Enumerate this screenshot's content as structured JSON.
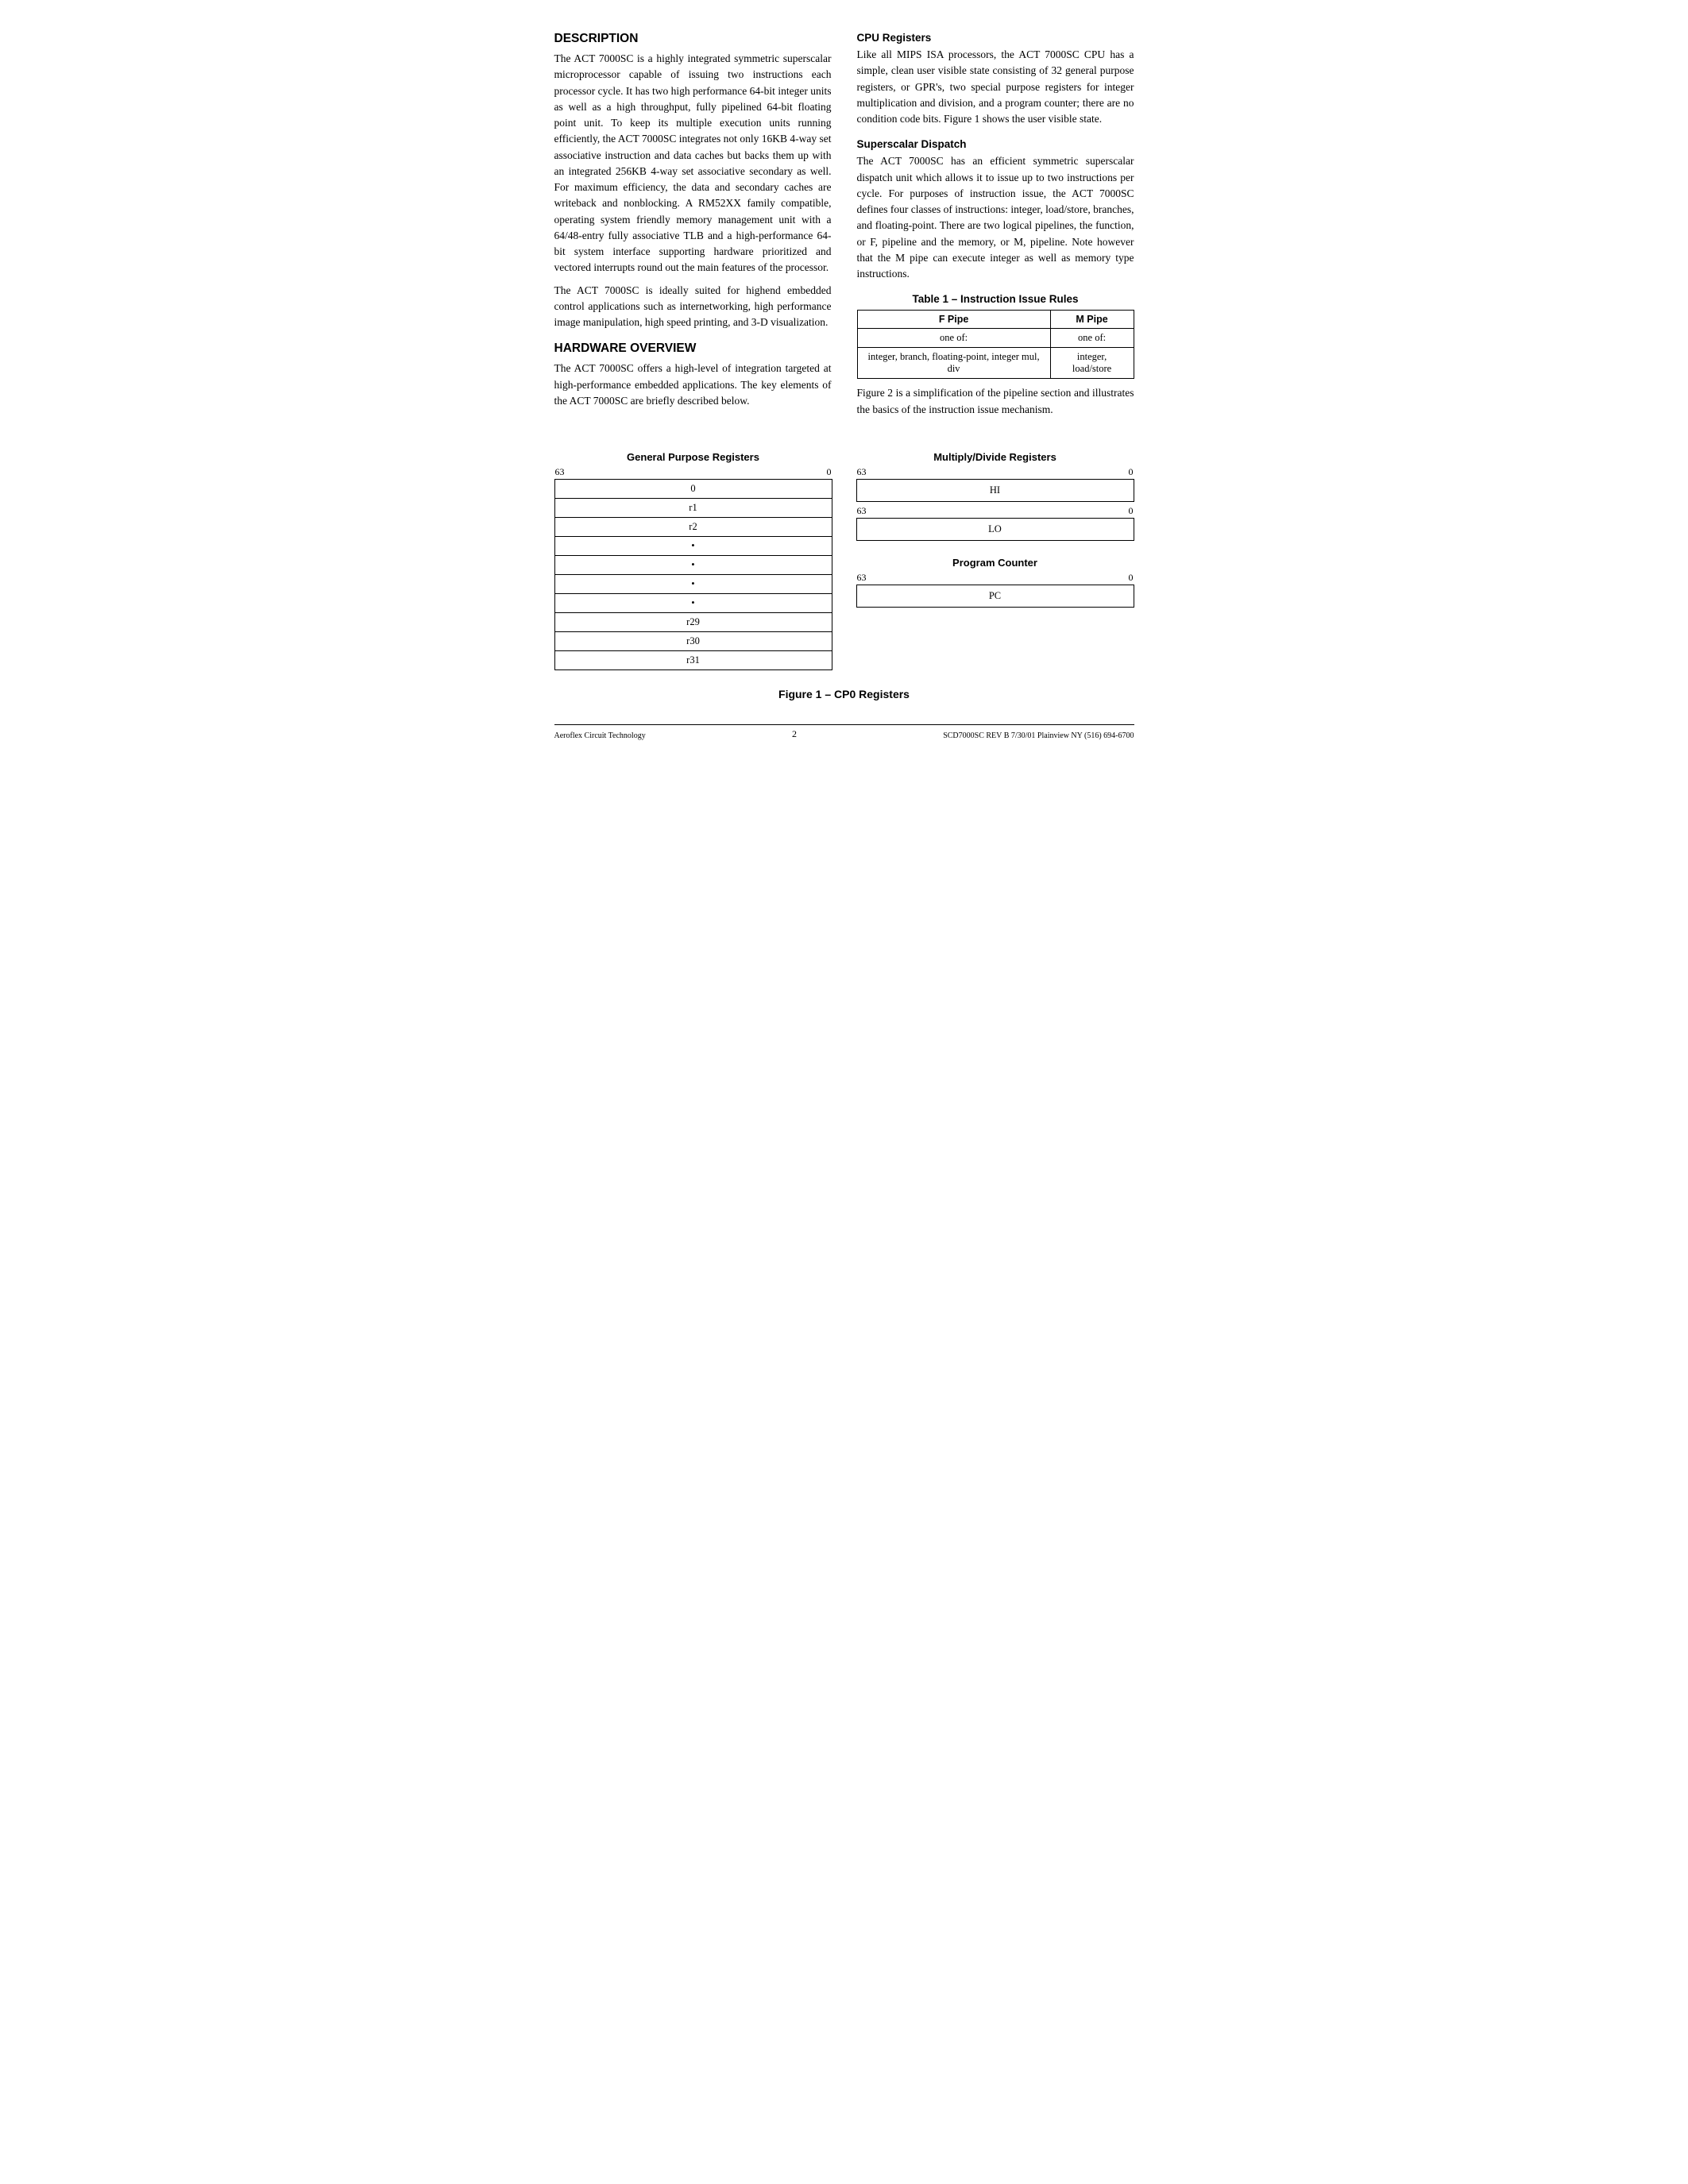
{
  "description": {
    "heading": "DESCRIPTION",
    "paragraph1": "The ACT 7000SC is a highly integrated symmetric superscalar microprocessor capable of issuing two instructions each processor cycle. It has two high performance 64-bit integer units as well as a high throughput, fully pipelined 64-bit floating point unit. To keep its multiple execution units running efficiently, the ACT 7000SC integrates not only 16KB 4-way set associative instruction and data caches but backs them up with an integrated 256KB 4-way set associative secondary as well. For maximum efficiency, the data and secondary caches are writeback and nonblocking. A RM52XX family compatible, operating system friendly memory management unit with a 64/48-entry fully associative TLB and a high-performance 64-bit system interface supporting hardware prioritized and vectored interrupts round out the main features of the processor.",
    "paragraph2": "The ACT 7000SC is ideally suited for highend embedded control applications such as internetworking, high performance image manipulation, high speed printing, and 3-D visualization."
  },
  "hardware_overview": {
    "heading": "HARDWARE OVERVIEW",
    "paragraph1": "The ACT 7000SC offers a high-level of integration targeted at high-performance embedded applications. The key elements of the ACT 7000SC are briefly described below."
  },
  "cpu_registers": {
    "heading": "CPU Registers",
    "paragraph1": "Like all MIPS ISA processors, the ACT 7000SC CPU has a simple, clean user visible state consisting of 32 general purpose registers, or GPR's, two special purpose registers for integer multiplication and division, and a program counter; there are no condition code bits. Figure 1 shows the user visible state."
  },
  "superscalar_dispatch": {
    "heading": "Superscalar Dispatch",
    "paragraph1": "The ACT 7000SC has an efficient symmetric superscalar dispatch unit which allows it to issue up to two instructions per cycle. For purposes of instruction issue, the ACT 7000SC defines four classes of instructions: integer, load/store, branches, and floating-point. There are two logical pipelines, the function, or F, pipeline and the memory, or M, pipeline. Note however that the M pipe can execute integer as well as memory type instructions."
  },
  "table": {
    "title": "Table 1 – Instruction Issue Rules",
    "col1_header": "F Pipe",
    "col2_header": "M Pipe",
    "row1_col1": "one of:",
    "row1_col2": "one of:",
    "row2_col1": "integer, branch, floating-point, integer mul, div",
    "row2_col2": "integer, load/store"
  },
  "figure_paragraph": "Figure 2 is a simplification of the pipeline section and illustrates the basics of the instruction issue mechanism.",
  "gpr": {
    "title": "General Purpose Registers",
    "bit_high": "63",
    "bit_low": "0",
    "rows": [
      "0",
      "r1",
      "r2",
      "•",
      "•",
      "•",
      "•",
      "r29",
      "r30",
      "r31"
    ]
  },
  "mdr": {
    "title": "Multiply/Divide Registers",
    "hi_label": "HI",
    "lo_label": "LO",
    "bit_high": "63",
    "bit_low": "0"
  },
  "pc": {
    "title": "Program Counter",
    "label": "PC",
    "bit_high": "63",
    "bit_low": "0"
  },
  "figure_caption": "Figure 1 – CP0 Registers",
  "footer": {
    "left": "Aeroflex Circuit Technology",
    "center": "2",
    "right": "SCD7000SC REV B  7/30/01  Plainview NY (516) 694-6700"
  }
}
